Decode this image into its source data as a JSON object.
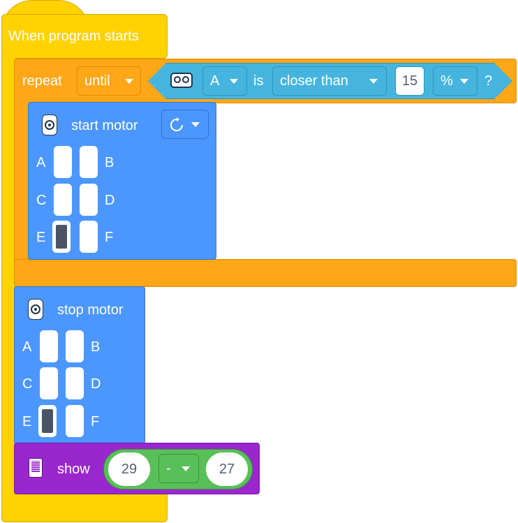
{
  "event_block": {
    "label": "When program starts"
  },
  "repeat_block": {
    "label": "repeat",
    "mode_dropdown": "until",
    "condition": {
      "sensor_icon": "distance-sensor-icon",
      "port": "A",
      "is_label": "is",
      "comparison": "closer than",
      "value": "15",
      "unit": "%",
      "question": "?"
    }
  },
  "start_motor": {
    "label": "start motor",
    "direction_icon": "clockwise-icon",
    "ports": [
      {
        "left": "A",
        "right": "B",
        "left_on": false,
        "right_on": false
      },
      {
        "left": "C",
        "right": "D",
        "left_on": false,
        "right_on": false
      },
      {
        "left": "E",
        "right": "F",
        "left_on": true,
        "right_on": false
      }
    ]
  },
  "stop_motor": {
    "label": "stop motor",
    "ports": [
      {
        "left": "A",
        "right": "B",
        "left_on": false,
        "right_on": false
      },
      {
        "left": "C",
        "right": "D",
        "left_on": false,
        "right_on": false
      },
      {
        "left": "E",
        "right": "F",
        "left_on": true,
        "right_on": false
      }
    ]
  },
  "show_block": {
    "label": "show",
    "icon": "light-matrix-icon",
    "operand_a": "29",
    "operator": "-",
    "operand_b": "27"
  },
  "colors": {
    "event": "#ffd200",
    "control": "#ffa717",
    "sensor": "#45b5e0",
    "motor": "#4c97ff",
    "display": "#9a27ce",
    "operator": "#59c059"
  }
}
